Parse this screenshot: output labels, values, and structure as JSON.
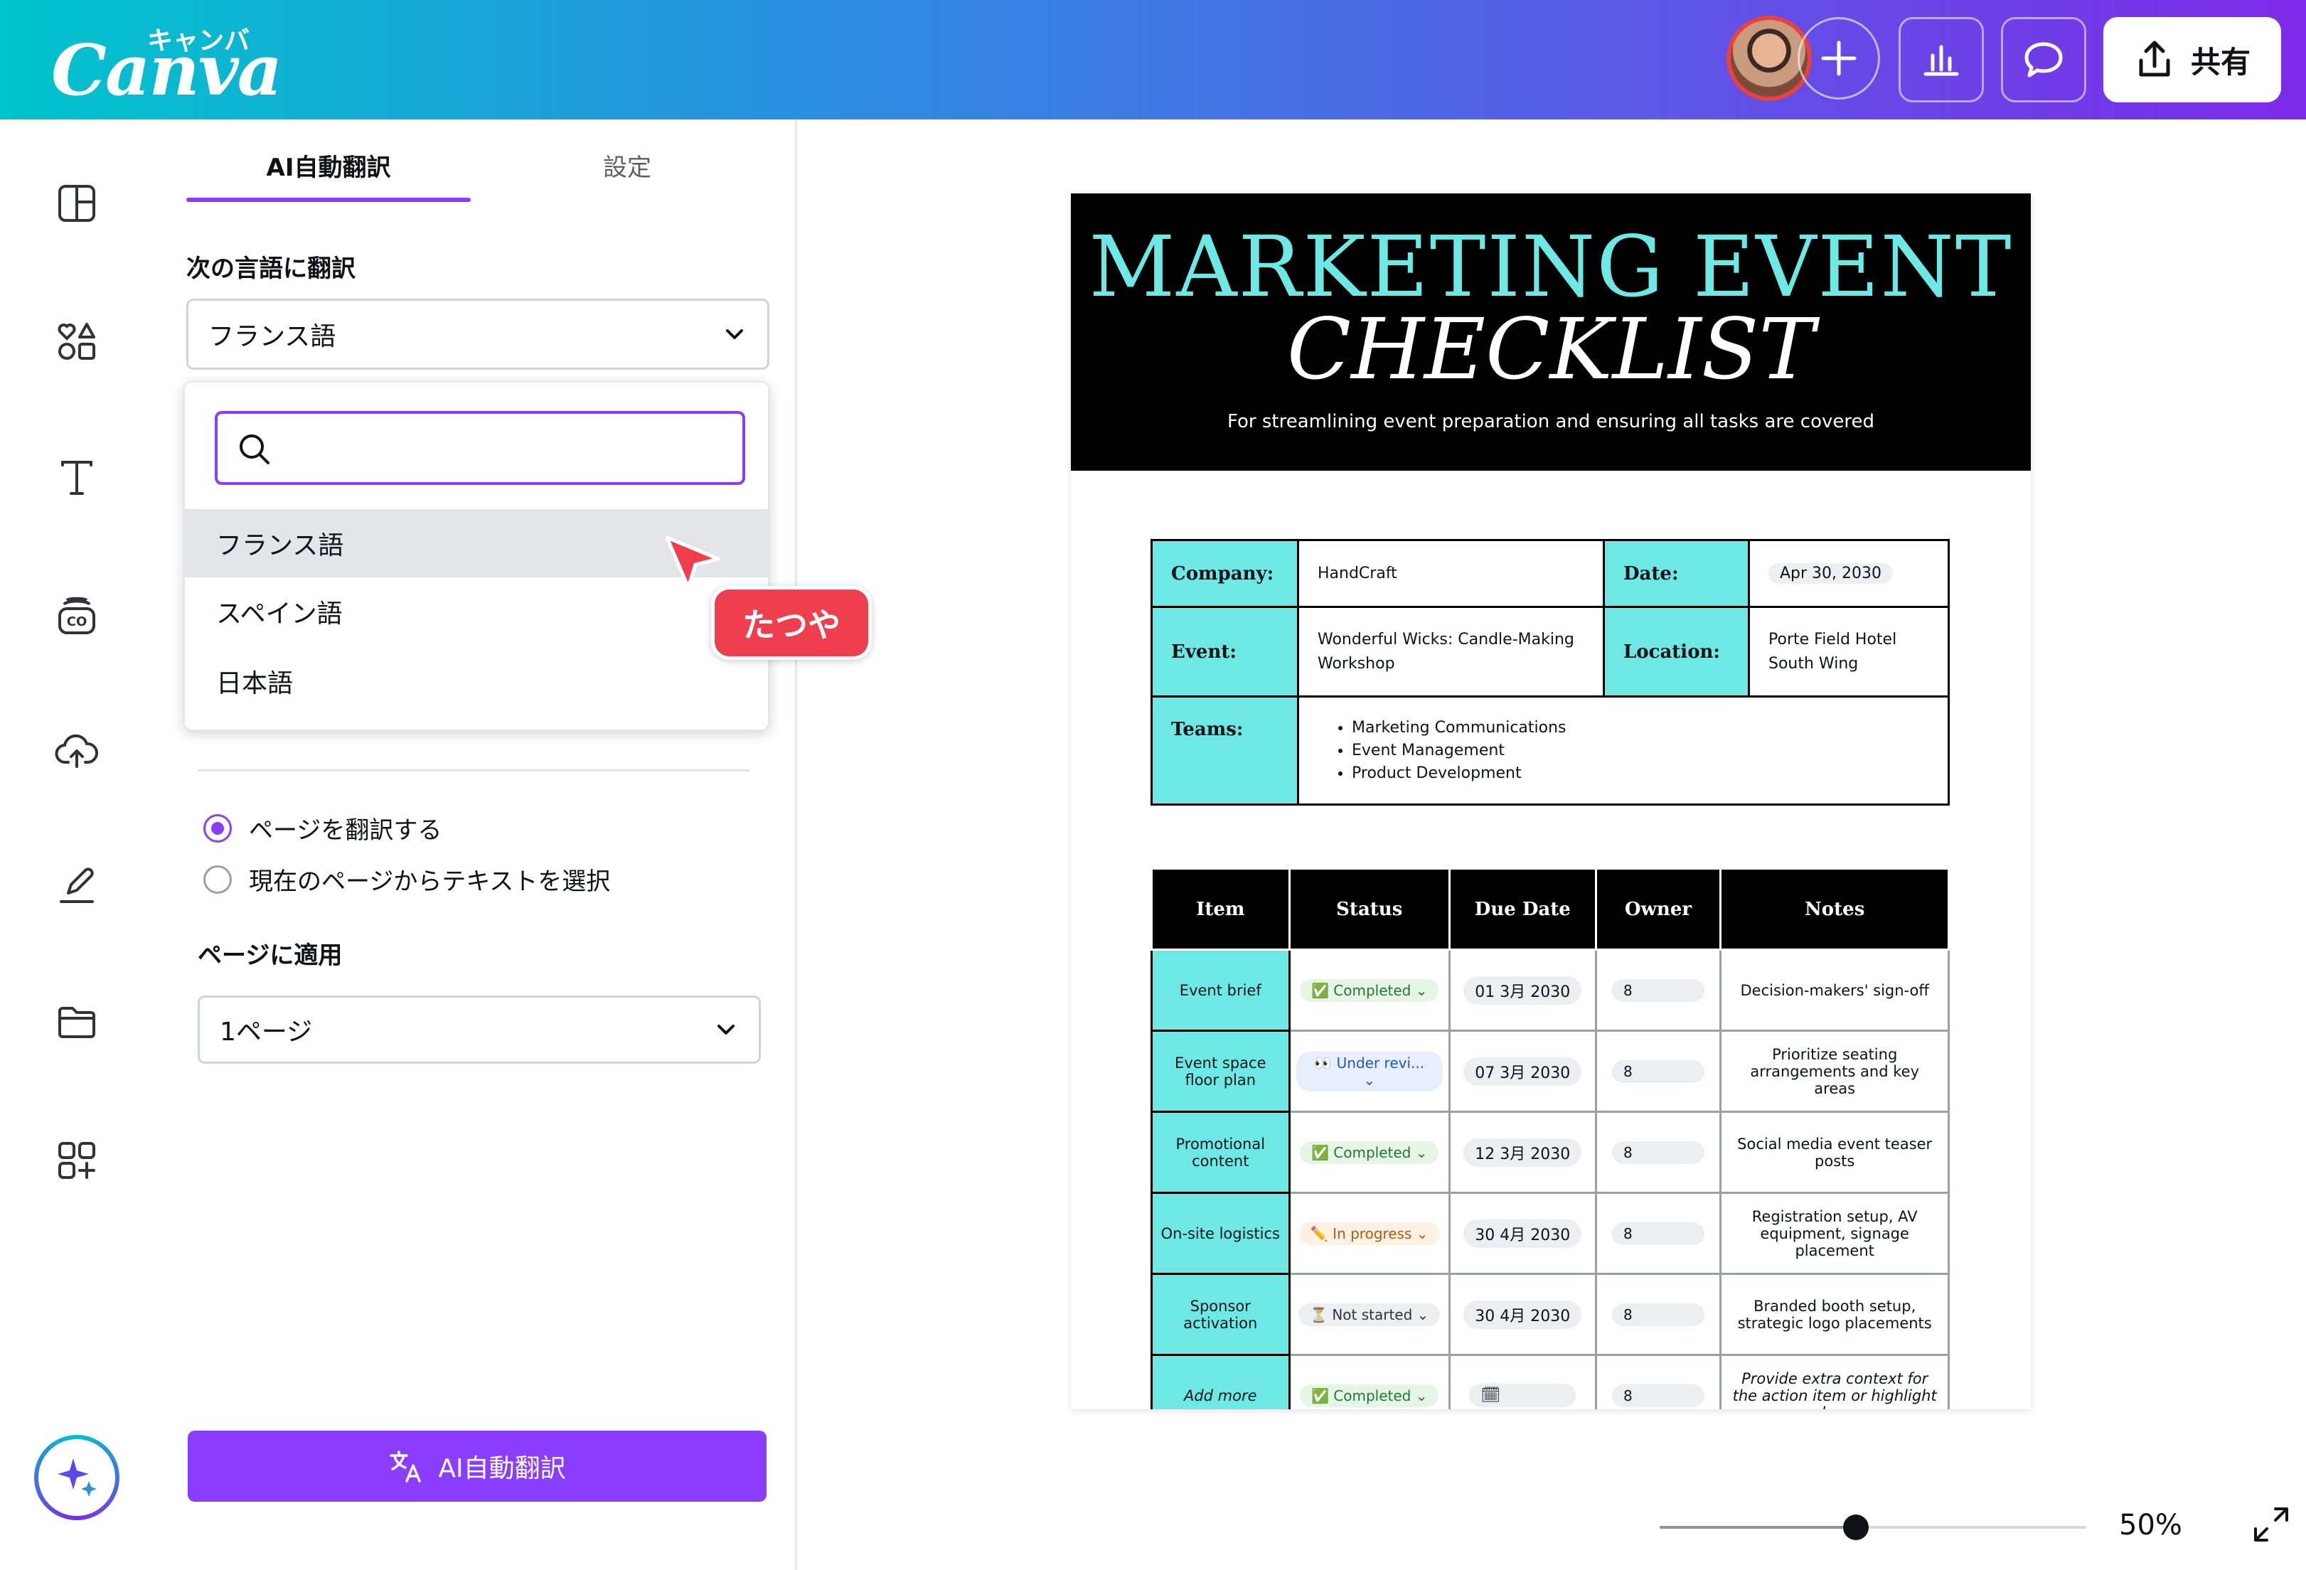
{
  "header": {
    "logo": "Canva",
    "logo_kana": "キャンバ",
    "share_label": "共有",
    "icons": [
      "avatar",
      "plus-icon",
      "insights-icon",
      "comment-icon",
      "share-icon"
    ]
  },
  "rail": {
    "icons": [
      "layout-icon",
      "elements-icon",
      "text-icon",
      "brand-icon",
      "upload-icon",
      "draw-icon",
      "folder-icon",
      "apps-icon",
      "magic-icon"
    ]
  },
  "panel": {
    "tabs": [
      {
        "label": "AI自動翻訳",
        "active": true
      },
      {
        "label": "設定",
        "active": false
      }
    ],
    "translate_to_label": "次の言語に翻訳",
    "language_select": {
      "value": "フランス語"
    },
    "search": {
      "value": "",
      "placeholder": ""
    },
    "options": [
      {
        "label": "フランス語",
        "selected": true
      },
      {
        "label": "スペイン語",
        "selected": false
      },
      {
        "label": "日本語",
        "selected": false
      }
    ],
    "radios": [
      {
        "label": "ページを翻訳する",
        "checked": true
      },
      {
        "label": "現在のページからテキストを選択",
        "checked": false
      }
    ],
    "apply_label": "ページに適用",
    "page_select": {
      "value": "1ページ"
    },
    "primary_button": "AI自動翻訳"
  },
  "collaborator": {
    "name": "たつや"
  },
  "document": {
    "title_line1": "MARKETING EVENT",
    "title_line2": "CHECKLIST",
    "subtitle": "For streamlining event preparation and ensuring all tasks are covered",
    "info": {
      "company_label": "Company:",
      "company": "HandCraft",
      "date_label": "Date:",
      "date": "Apr 30, 2030",
      "event_label": "Event:",
      "event": "Wonderful Wicks: Candle-Making Workshop",
      "location_label": "Location:",
      "location": "Porte Field Hotel South Wing",
      "teams_label": "Teams:",
      "teams": [
        "Marketing Communications",
        "Event Management",
        "Product Development"
      ]
    },
    "table": {
      "headers": [
        "Item",
        "Status",
        "Due Date",
        "Owner",
        "Notes"
      ],
      "rows": [
        {
          "item": "Event brief",
          "status": "✅ Completed ⌄",
          "status_type": "completed",
          "due": "01 3月 2030",
          "owner": "8",
          "notes": "Decision-makers' sign-off"
        },
        {
          "item": "Event space floor plan",
          "status": "👀 Under revi... ⌄",
          "status_type": "review",
          "due": "07 3月 2030",
          "owner": "8",
          "notes": "Prioritize seating arrangements and key areas"
        },
        {
          "item": "Promotional content",
          "status": "✅ Completed ⌄",
          "status_type": "completed",
          "due": "12 3月 2030",
          "owner": "8",
          "notes": "Social media event teaser posts"
        },
        {
          "item": "On-site logistics",
          "status": "✏️ In progress ⌄",
          "status_type": "progress",
          "due": "30 4月 2030",
          "owner": "8",
          "notes": "Registration setup, AV equipment, signage placement"
        },
        {
          "item": "Sponsor activation",
          "status": "⏳ Not started ⌄",
          "status_type": "notstarted",
          "due": "30 4月 2030",
          "owner": "8",
          "notes": "Branded booth setup, strategic logo placements"
        },
        {
          "item": "Add more",
          "status": "✅ Completed ⌄",
          "status_type": "completed",
          "due": "🗓",
          "owner": "8",
          "notes": "Provide extra context for the action item or highlight key"
        }
      ]
    }
  },
  "zoom": {
    "value": "50%",
    "level": 0.5
  },
  "colors": {
    "accent": "#8b3dff",
    "teal": "#6de8e5",
    "tag": "#ef3e4d"
  }
}
